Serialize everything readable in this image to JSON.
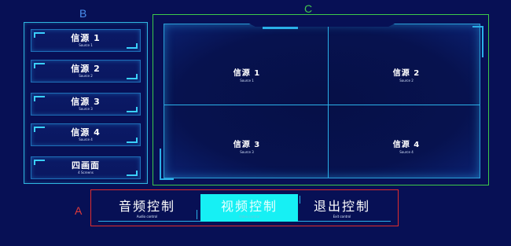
{
  "labels": {
    "b": "B",
    "c": "C",
    "a": "A"
  },
  "sources": [
    {
      "label": "信源 1",
      "sub": "Source 1"
    },
    {
      "label": "信源 2",
      "sub": "Source 2"
    },
    {
      "label": "信源 3",
      "sub": "Source 3"
    },
    {
      "label": "信源 4",
      "sub": "Source 4"
    },
    {
      "label": "四画面",
      "sub": "4 Screens"
    }
  ],
  "preview": [
    {
      "label": "信源 1",
      "sub": "Source 1"
    },
    {
      "label": "信源 2",
      "sub": "Source 2"
    },
    {
      "label": "信源 3",
      "sub": "Source 3"
    },
    {
      "label": "信源 4",
      "sub": "Source 4"
    }
  ],
  "controls": {
    "audio": {
      "label": "音频控制",
      "sub": "Audio control"
    },
    "video": {
      "label": "视频控制",
      "sub": "Video control"
    },
    "exit": {
      "label": "退出控制",
      "sub": "Exit control"
    }
  },
  "colors": {
    "background": "#071055",
    "accent": "#16f0f4",
    "line": "#2ab0e8",
    "label_b": "#4a8ff0",
    "label_c": "#43c64f",
    "label_a": "#e23a3a"
  }
}
